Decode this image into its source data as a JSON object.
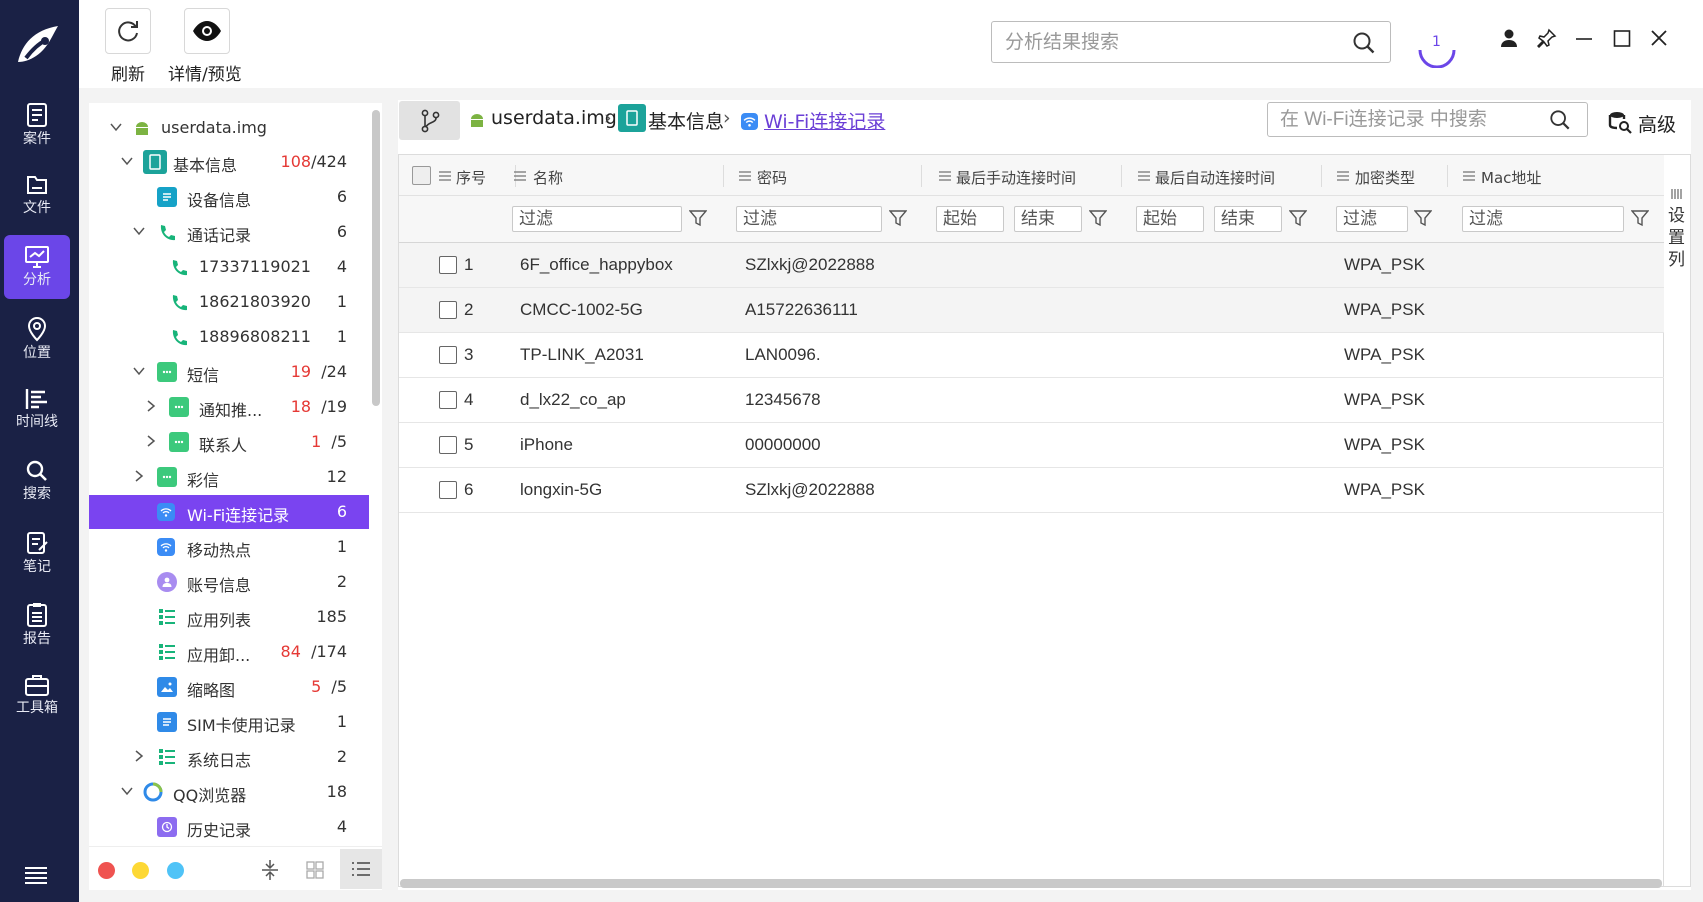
{
  "toolbar": {
    "refresh_label": "刷新",
    "detail_label": "详情/预览"
  },
  "search": {
    "placeholder": "分析结果搜索"
  },
  "progress_indicator": "1",
  "nav": [
    {
      "label": "案件",
      "icon": "case-icon"
    },
    {
      "label": "文件",
      "icon": "folder-icon"
    },
    {
      "label": "分析",
      "icon": "analysis-icon",
      "active": true
    },
    {
      "label": "位置",
      "icon": "location-icon"
    },
    {
      "label": "时间线",
      "icon": "timeline-icon"
    },
    {
      "label": "搜索",
      "icon": "search-icon"
    },
    {
      "label": "笔记",
      "icon": "note-icon"
    },
    {
      "label": "报告",
      "icon": "report-icon"
    },
    {
      "label": "工具箱",
      "icon": "toolbox-icon"
    }
  ],
  "tree": [
    {
      "label": "userdata.img",
      "count": "",
      "highlight": "",
      "total": ""
    },
    {
      "label": "基本信息",
      "count": "/424",
      "highlight": "108"
    },
    {
      "label": "设备信息",
      "count": "6"
    },
    {
      "label": "通话记录",
      "count": "6"
    },
    {
      "label": "17337119021",
      "count": "4"
    },
    {
      "label": "18621803920",
      "count": "1"
    },
    {
      "label": "18896808211",
      "count": "1"
    },
    {
      "label": "短信",
      "count": "/24",
      "highlight": "19"
    },
    {
      "label": "通知推...",
      "count": "/19",
      "highlight": "18"
    },
    {
      "label": "联系人",
      "count": "/5",
      "highlight": "1"
    },
    {
      "label": "彩信",
      "count": "12"
    },
    {
      "label": "Wi-Fi连接记录",
      "count": "6",
      "selected": true
    },
    {
      "label": "移动热点",
      "count": "1"
    },
    {
      "label": "账号信息",
      "count": "2"
    },
    {
      "label": "应用列表",
      "count": "185"
    },
    {
      "label": "应用卸...",
      "count": "/174",
      "highlight": "84"
    },
    {
      "label": "缩略图",
      "count": "/5",
      "highlight": "5"
    },
    {
      "label": "SIM卡使用记录",
      "count": "1"
    },
    {
      "label": "系统日志",
      "count": "2"
    },
    {
      "label": "QQ浏览器",
      "count": "18"
    },
    {
      "label": "历史记录",
      "count": "4"
    }
  ],
  "breadcrumb": {
    "root": "userdata.img",
    "mid": "基本信息",
    "current": "Wi-Fi连接记录",
    "search_placeholder": "在 Wi-Fi连接记录 中搜索",
    "advanced_label": "高级"
  },
  "table": {
    "columns": [
      "序号",
      "名称",
      "密码",
      "最后手动连接时间",
      "最后自动连接时间",
      "加密类型",
      "Mac地址"
    ],
    "filter_placeholder": "过滤",
    "start_placeholder": "起始",
    "end_placeholder": "结束",
    "rows": [
      {
        "no": "1",
        "name": "6F_office_happybox",
        "password": "SZlxkj@2022888",
        "manual": "",
        "auto": "",
        "enc": "WPA_PSK",
        "mac": ""
      },
      {
        "no": "2",
        "name": "CMCC-1002-5G",
        "password": "A15722636111",
        "manual": "",
        "auto": "",
        "enc": "WPA_PSK",
        "mac": ""
      },
      {
        "no": "3",
        "name": "TP-LINK_A2031",
        "password": "LAN0096.",
        "manual": "",
        "auto": "",
        "enc": "WPA_PSK",
        "mac": ""
      },
      {
        "no": "4",
        "name": "d_lx22_co_ap",
        "password": "12345678",
        "manual": "",
        "auto": "",
        "enc": "WPA_PSK",
        "mac": ""
      },
      {
        "no": "5",
        "name": "iPhone",
        "password": "00000000",
        "manual": "",
        "auto": "",
        "enc": "WPA_PSK",
        "mac": ""
      },
      {
        "no": "6",
        "name": "longxin-5G",
        "password": "SZlxkj@2022888",
        "manual": "",
        "auto": "",
        "enc": "WPA_PSK",
        "mac": ""
      }
    ]
  },
  "settings_column_label": "设置列",
  "colors": {
    "nav_bg": "#1a2145",
    "accent": "#6b46e8",
    "selected_row": "#7a44f0",
    "highlight_count": "#e53935"
  }
}
